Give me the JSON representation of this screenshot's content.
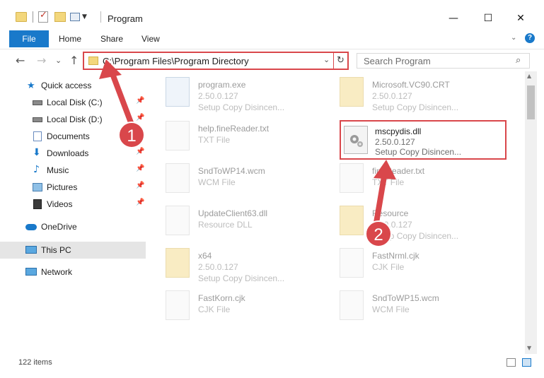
{
  "window": {
    "title": "Program",
    "min_glyph": "—",
    "max_glyph": "☐",
    "close_glyph": "✕"
  },
  "ribbon": {
    "tabs": [
      "File",
      "Home",
      "Share",
      "View"
    ],
    "collapse_glyph": "⌄",
    "help_glyph": "?"
  },
  "nav": {
    "back_glyph": "←",
    "forward_glyph": "→",
    "recent_glyph": "⌄",
    "up_glyph": "↑"
  },
  "address": {
    "path": "C:\\Program Files\\Program Directory",
    "dropdown_glyph": "⌄",
    "refresh_glyph": "↻"
  },
  "search": {
    "placeholder": "Search Program",
    "icon_glyph": "⌕"
  },
  "sidebar": {
    "pin_glyph": "📌",
    "items": [
      {
        "label": "Quick access",
        "icon": "star-icon"
      },
      {
        "label": "Local Disk (C:)",
        "icon": "drive-icon",
        "pinned": true
      },
      {
        "label": "Local Disk (D:)",
        "icon": "drive-icon",
        "pinned": true
      },
      {
        "label": "Documents",
        "icon": "documents-icon",
        "pinned": true
      },
      {
        "label": "Downloads",
        "icon": "downloads-icon",
        "pinned": true
      },
      {
        "label": "Music",
        "icon": "music-icon",
        "pinned": true
      },
      {
        "label": "Pictures",
        "icon": "pictures-icon",
        "pinned": true
      },
      {
        "label": "Videos",
        "icon": "videos-icon",
        "pinned": true
      },
      {
        "label": "OneDrive",
        "icon": "cloud-icon"
      },
      {
        "label": "This PC",
        "icon": "pc-icon",
        "selected": true
      },
      {
        "label": "Network",
        "icon": "network-icon"
      }
    ]
  },
  "files": [
    {
      "name": "program.exe",
      "line2": "2.50.0.127",
      "line3": "Setup Copy Disincen...",
      "kind": "exe"
    },
    {
      "name": "Microsoft.VC90.CRT",
      "line2": "2.50.0.127",
      "line3": "Setup Copy Disincen...",
      "kind": "folder"
    },
    {
      "name": "help.fineReader.txt",
      "line2": "TXT File",
      "line3": "",
      "kind": "doc"
    },
    {
      "name": "mscpydis.dll",
      "line2": "2.50.0.127",
      "line3": "Setup Copy Disincen...",
      "kind": "dll"
    },
    {
      "name": "SndToWP14.wcm",
      "line2": "WCM File",
      "line3": "",
      "kind": "doc"
    },
    {
      "name": "fineReader.txt",
      "line2": "TXT File",
      "line3": "",
      "kind": "doc"
    },
    {
      "name": "UpdateClient63.dll",
      "line2": "Resource DLL",
      "line3": "",
      "kind": "dll"
    },
    {
      "name": "Resource",
      "line2": "2.50.0.127",
      "line3": "Setup Copy Disincen...",
      "kind": "folder"
    },
    {
      "name": "x64",
      "line2": "2.50.0.127",
      "line3": "Setup Copy Disincen...",
      "kind": "folder"
    },
    {
      "name": "FastNrml.cjk",
      "line2": "CJK File",
      "line3": "",
      "kind": "doc"
    },
    {
      "name": "FastKorn.cjk",
      "line2": "CJK File",
      "line3": "",
      "kind": "doc"
    },
    {
      "name": "SndToWP15.wcm",
      "line2": "WCM File",
      "line3": "",
      "kind": "doc"
    }
  ],
  "status": {
    "count": "122 items"
  },
  "callouts": [
    "1",
    "2"
  ],
  "colors": {
    "accent": "#1979ca",
    "highlight": "#d9474b"
  }
}
